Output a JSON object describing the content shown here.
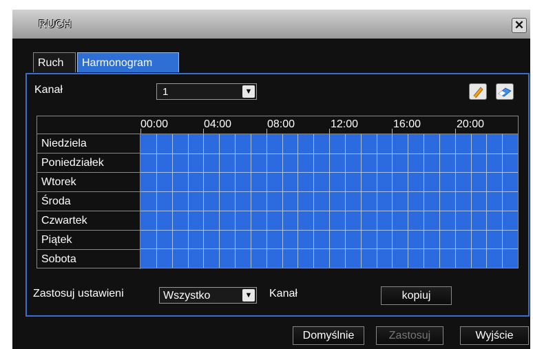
{
  "window": {
    "title": "RUCH",
    "close_label": "✕"
  },
  "tabs": [
    {
      "label": "Ruch",
      "active": false
    },
    {
      "label": "Harmonogram",
      "active": true
    }
  ],
  "kanal": {
    "label": "Kanał",
    "selected": "1"
  },
  "tools": {
    "edit_icon": "pencil-icon",
    "erase_icon": "eraser-icon"
  },
  "schedule": {
    "hour_labels": [
      "00:00",
      "04:00",
      "08:00",
      "12:00",
      "16:00",
      "20:00"
    ],
    "days": [
      "Niedziela",
      "Poniedziałek",
      "Wtorek",
      "Środa",
      "Czwartek",
      "Piątek",
      "Sobota"
    ],
    "slots_per_day": 24,
    "all_slots_enabled": true,
    "active_color": "#2c6ae0"
  },
  "apply": {
    "label": "Zastosuj ustawieni",
    "selected": "Wszystko",
    "suffix_label": "Kanał",
    "copy_button": "kopiuj"
  },
  "footer": {
    "default_button": "Domyślnie",
    "apply_button": "Zastosuj",
    "exit_button": "Wyjście"
  }
}
